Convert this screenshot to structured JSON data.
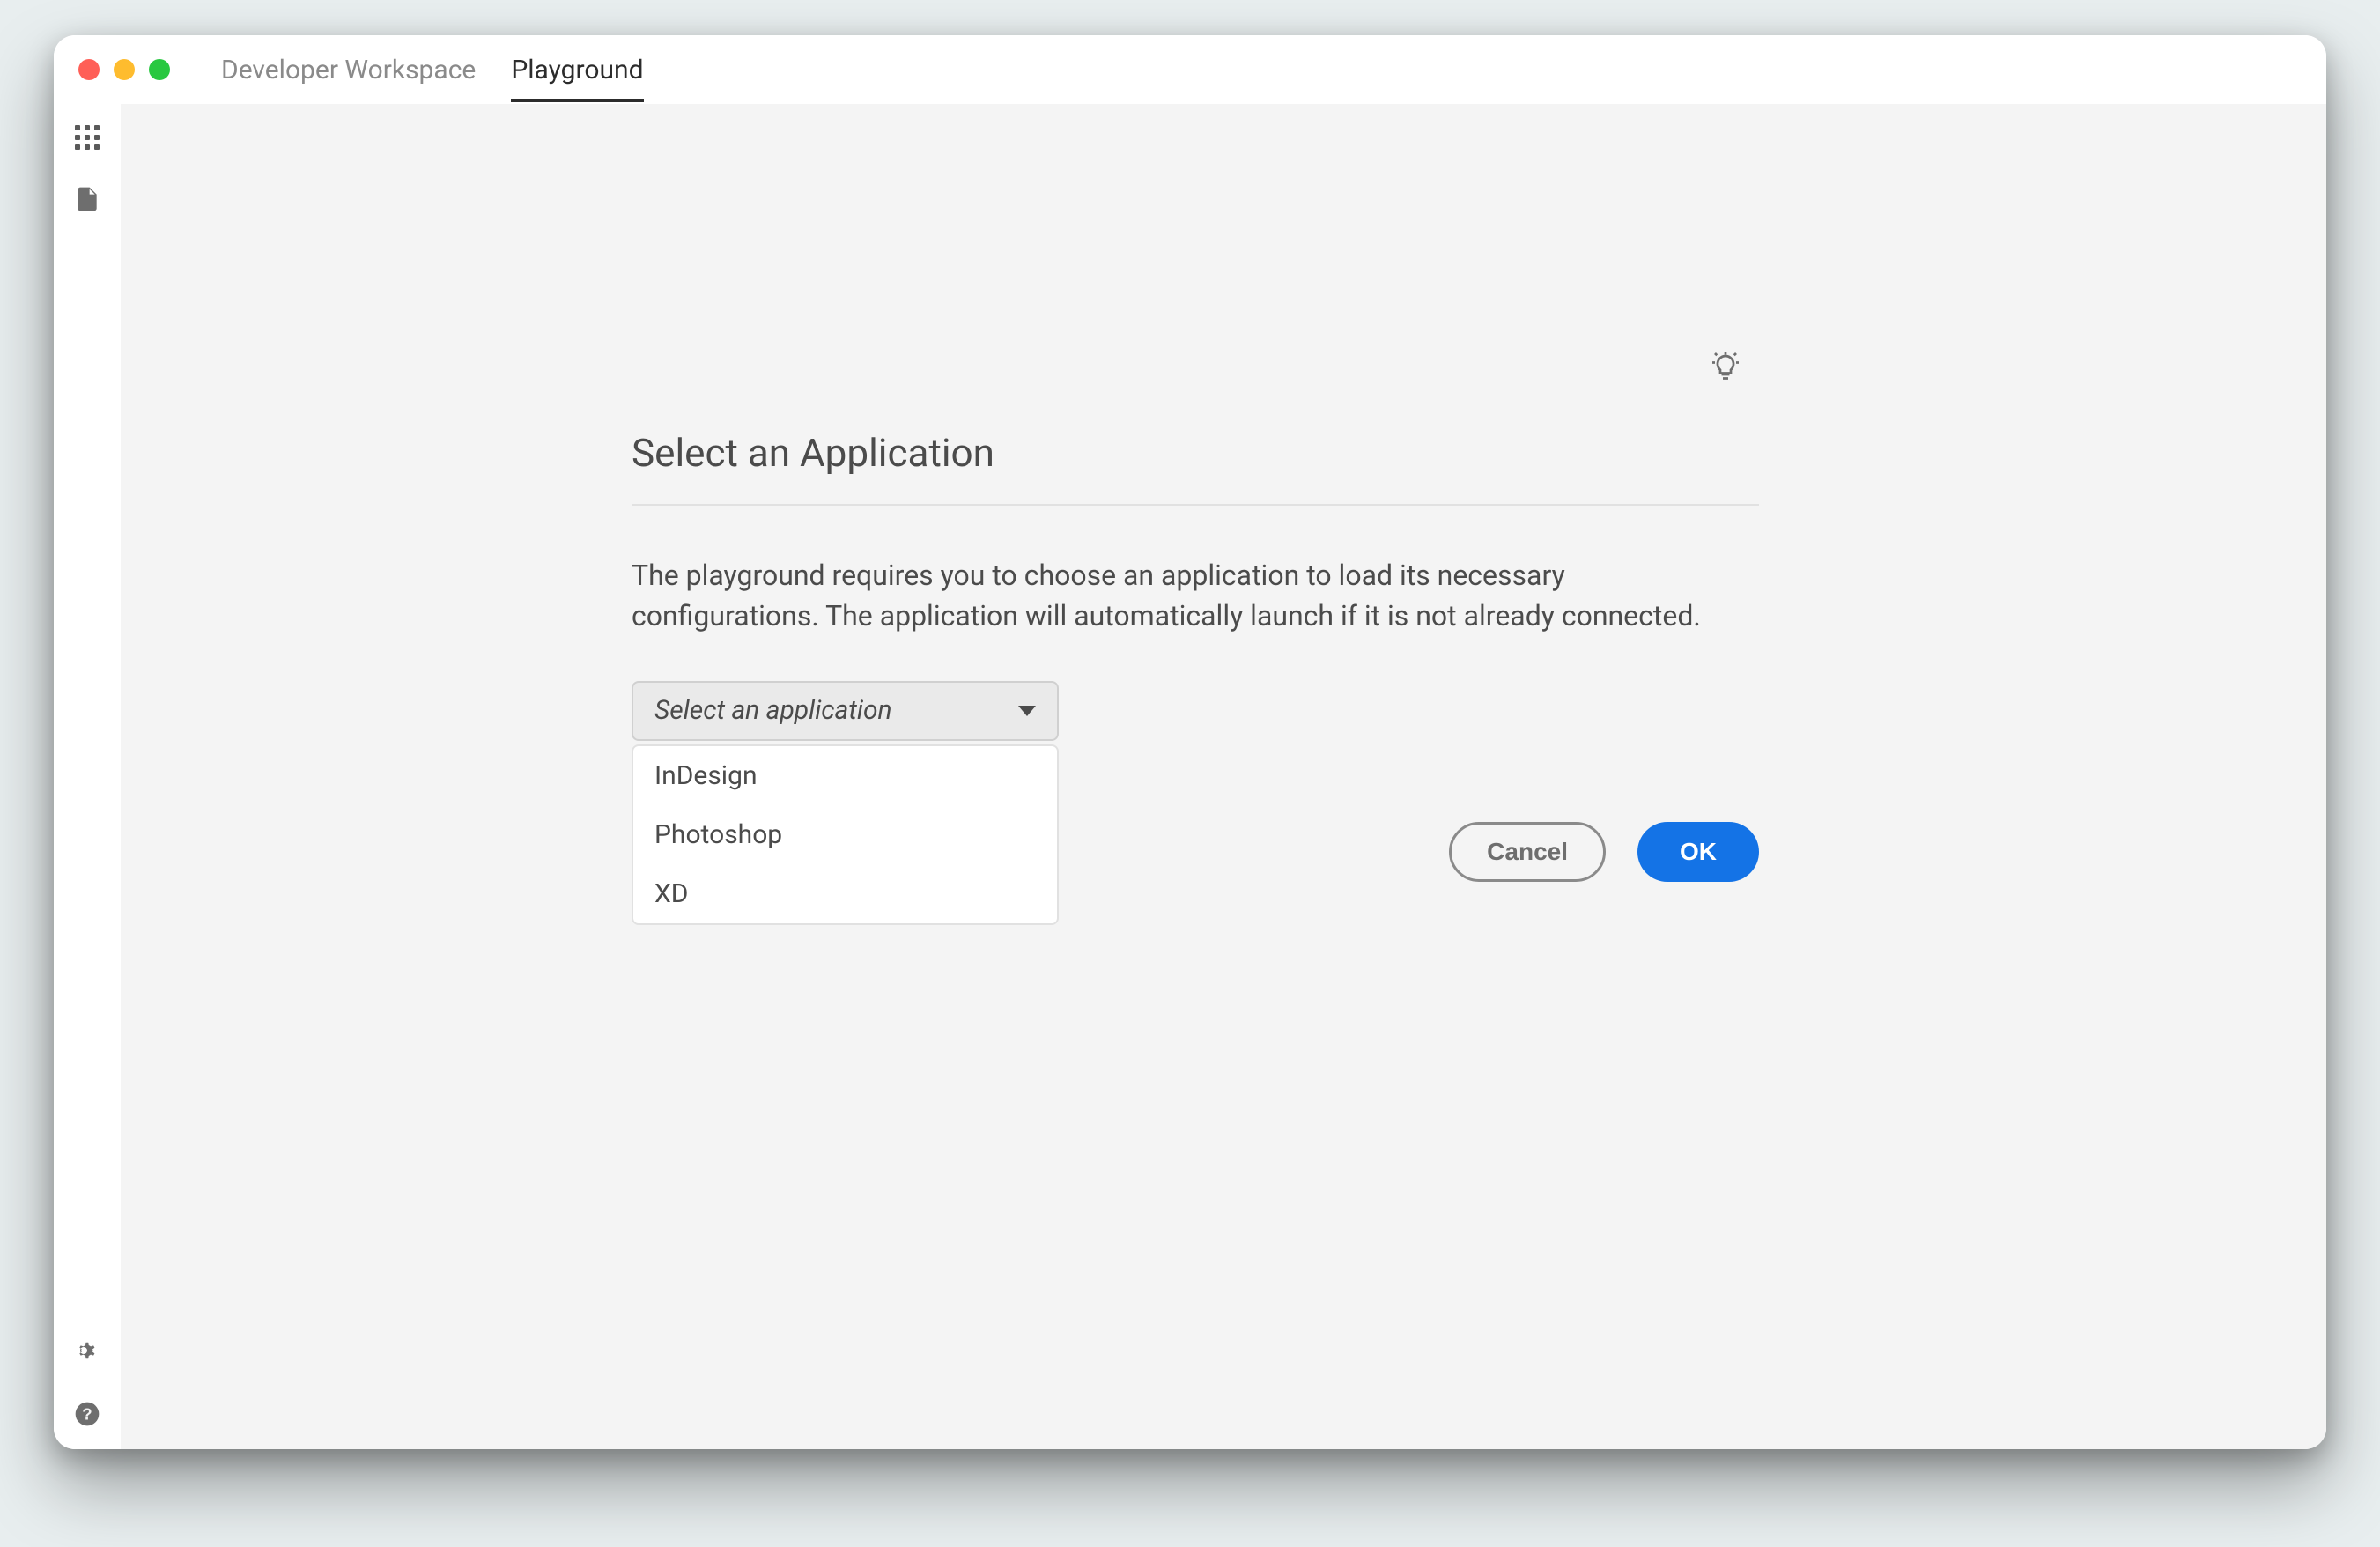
{
  "tabs": {
    "workspace": "Developer Workspace",
    "playground": "Playground"
  },
  "dialog": {
    "title": "Select an Application",
    "description": "The playground requires you to choose an application to load its necessary configurations. The application will automatically launch if it is not already connected.",
    "select_placeholder": "Select an application",
    "options": {
      "indesign": "InDesign",
      "photoshop": "Photoshop",
      "xd": "XD"
    },
    "cancel_label": "Cancel",
    "ok_label": "OK"
  }
}
